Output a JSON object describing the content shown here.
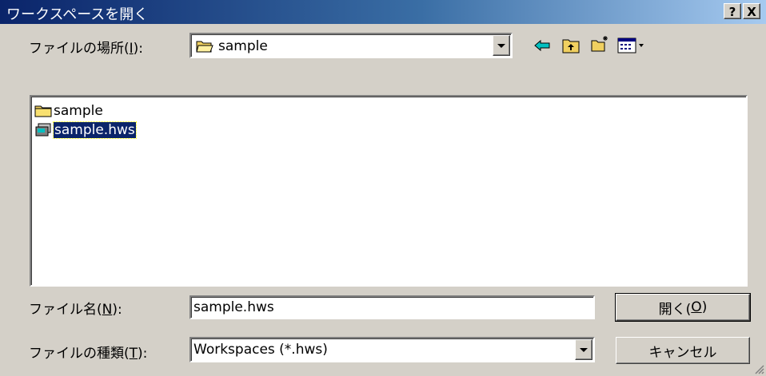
{
  "dialog": {
    "title": "ワークスペースを開く",
    "help_button": "?",
    "close_button": "X"
  },
  "location": {
    "label_prefix": "ファイルの場所(",
    "label_key": "I",
    "label_suffix": "):",
    "value": "sample"
  },
  "toolbar": {
    "icons": [
      "back-icon",
      "up-folder-icon",
      "new-folder-icon",
      "view-menu-icon"
    ]
  },
  "files": {
    "items": [
      {
        "name": "sample",
        "icon": "folder-icon",
        "selected": false
      },
      {
        "name": "sample.hws",
        "icon": "workspace-file-icon",
        "selected": true
      }
    ]
  },
  "filename": {
    "label_prefix": "ファイル名(",
    "label_key": "N",
    "label_suffix": "):",
    "value": "sample.hws"
  },
  "filetype": {
    "label_prefix": "ファイルの種類(",
    "label_key": "T",
    "label_suffix": "):",
    "value": "Workspaces (*.hws)"
  },
  "buttons": {
    "open_prefix": "開く(",
    "open_key": "O",
    "open_suffix": ")",
    "cancel": "キャンセル"
  },
  "colors": {
    "face": "#d4d0c8",
    "title_start": "#0a246a",
    "title_end": "#a6caf0",
    "selection": "#0a246a"
  }
}
